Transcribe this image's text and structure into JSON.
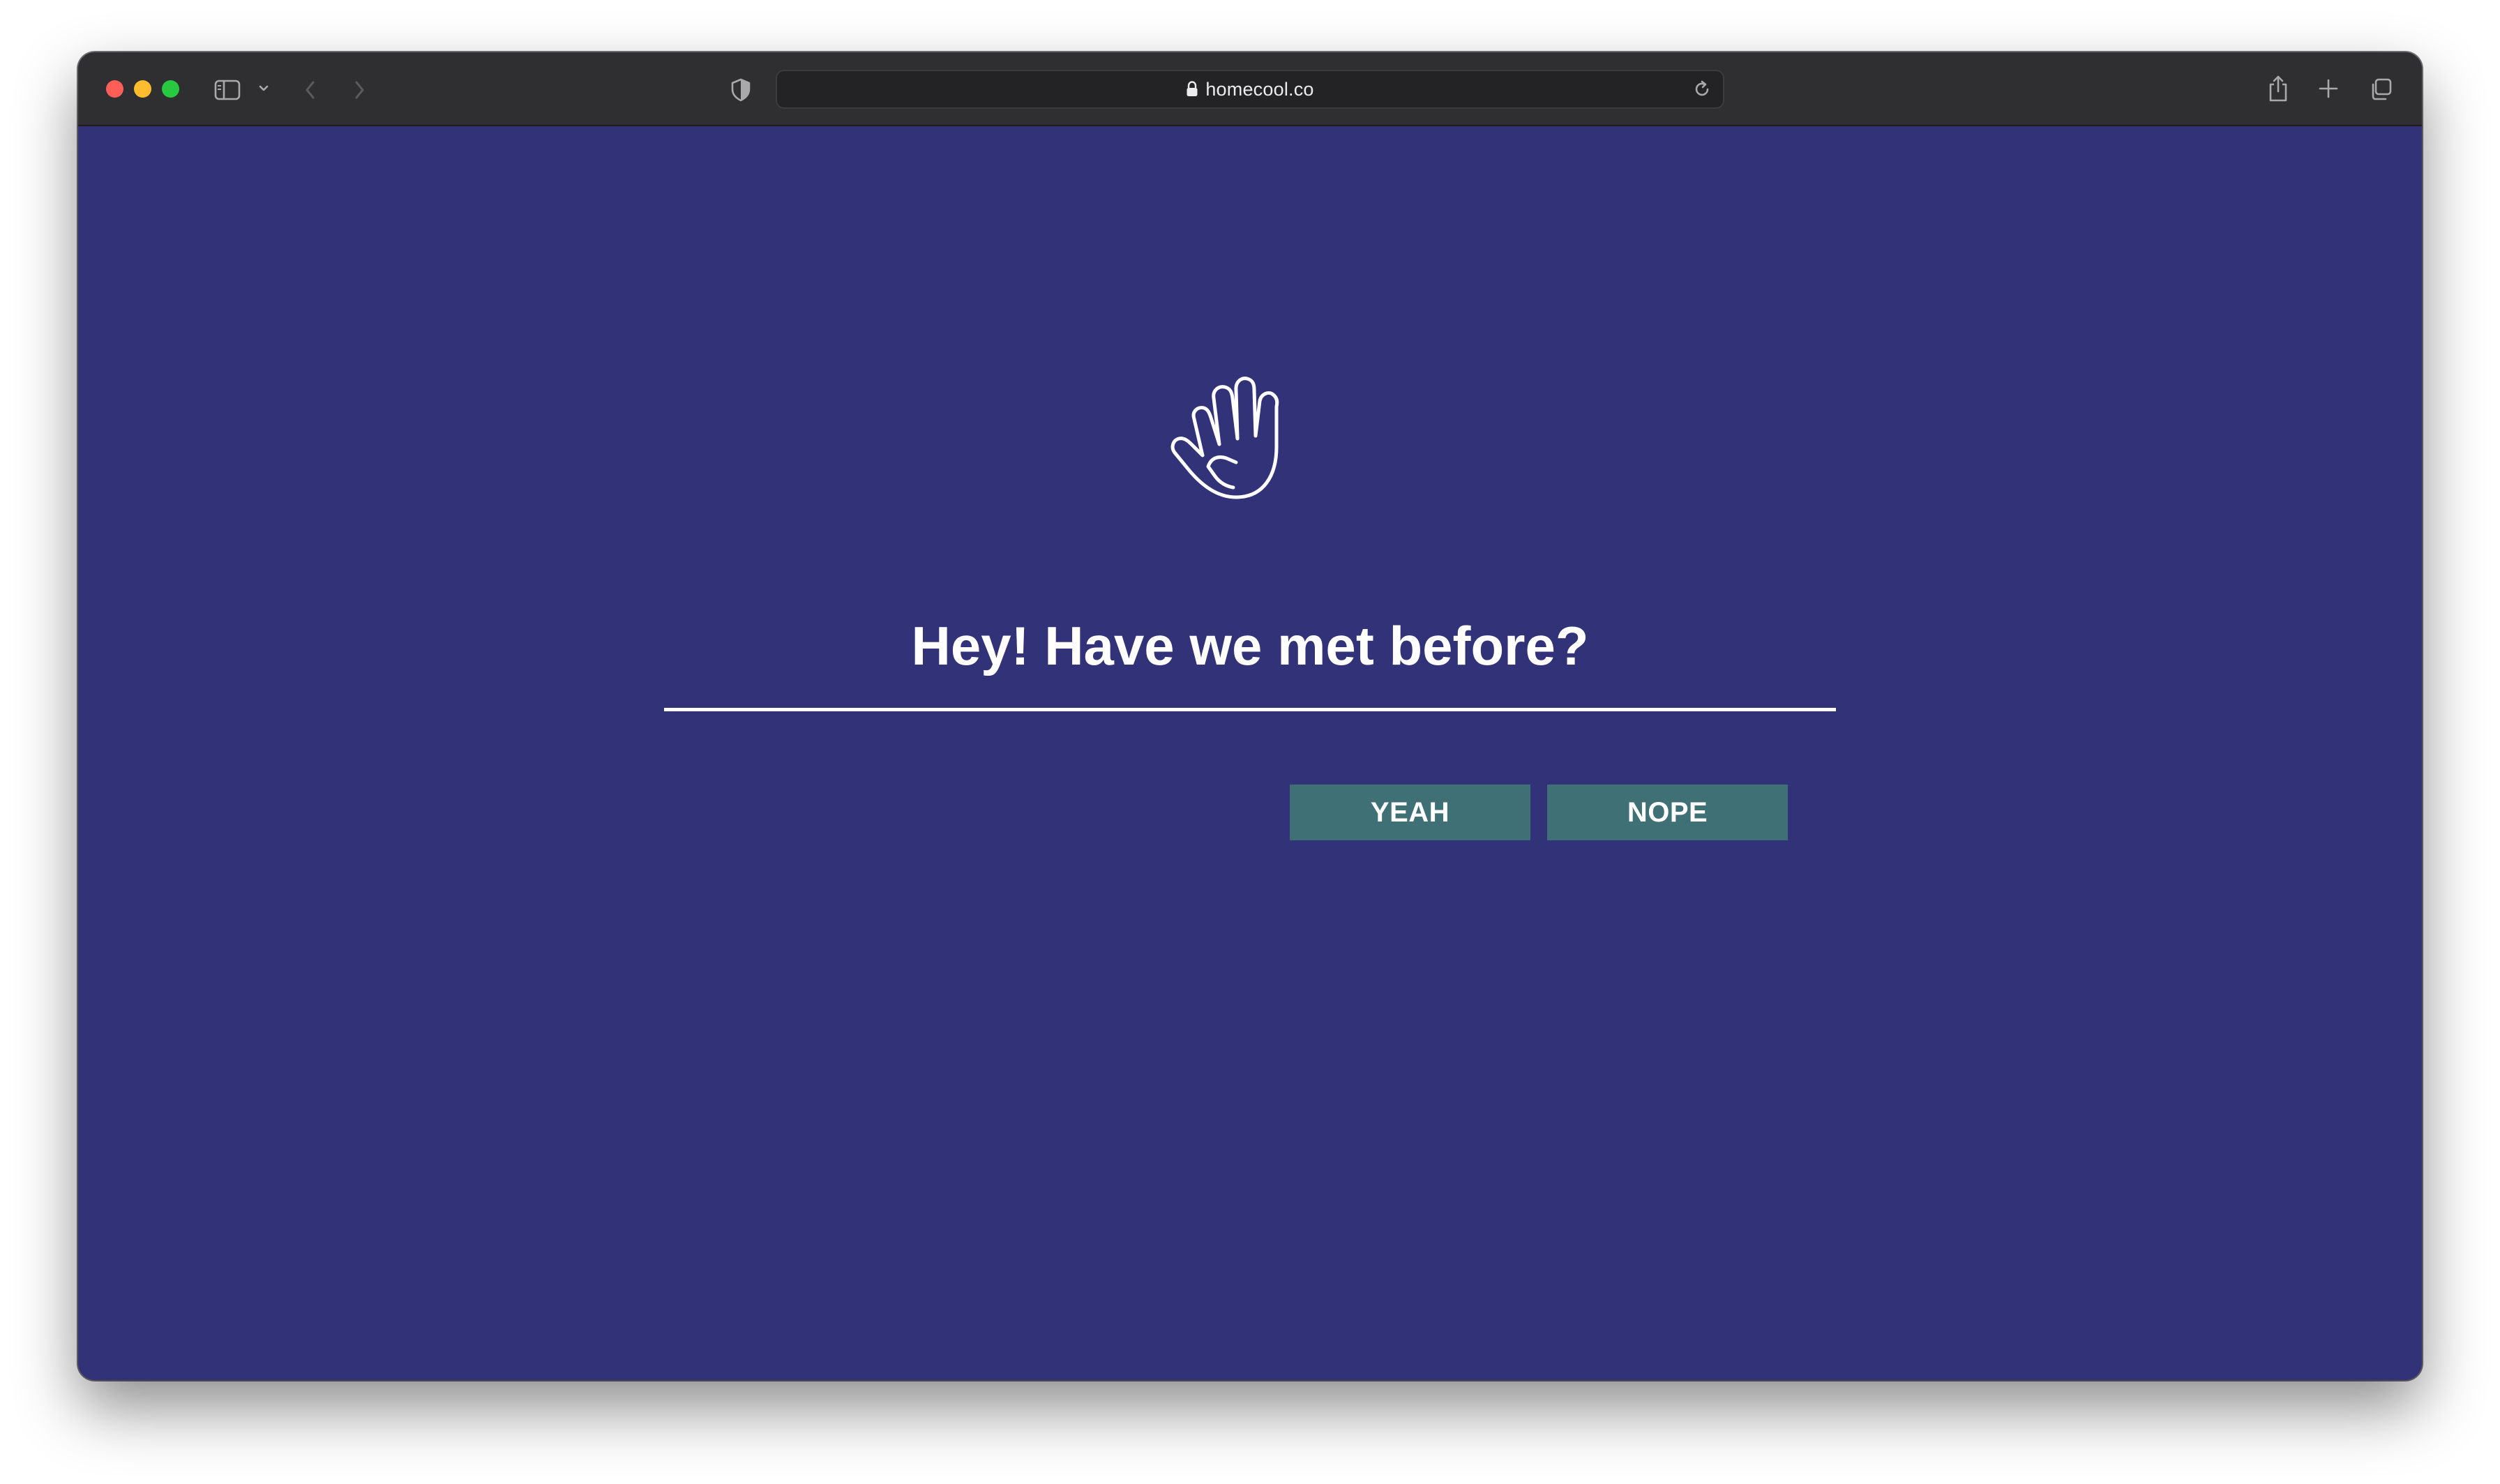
{
  "browser": {
    "url": "homecool.co",
    "traffic_colors": {
      "close": "#ff5f57",
      "minimize": "#febc2e",
      "maximize": "#28c840"
    },
    "icons": {
      "sidebar": "sidebar-icon",
      "sidebar_menu": "chevron-down-icon",
      "back": "chevron-left-icon",
      "forward": "chevron-right-icon",
      "privacy": "shield-icon",
      "lock": "lock-icon",
      "reload": "reload-icon",
      "share": "share-icon",
      "new_tab": "plus-icon",
      "tabs": "tab-overview-icon"
    }
  },
  "page": {
    "background_color": "#323278",
    "icon": "waving-hand-icon",
    "question": "Hey! Have we met before?",
    "buttons": {
      "yes_label": "YEAH",
      "no_label": "NOPE",
      "color": "#3f7075"
    }
  }
}
